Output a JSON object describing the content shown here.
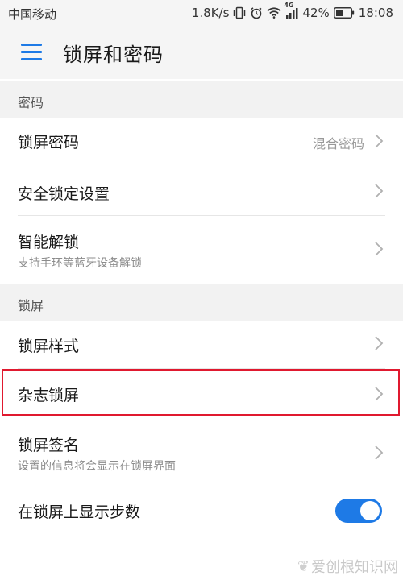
{
  "status_bar": {
    "carrier": "中国移动",
    "speed": "1.8K/s",
    "network": "4G",
    "battery": "42%",
    "time": "18:08"
  },
  "app_bar": {
    "title": "锁屏和密码"
  },
  "sections": {
    "password": {
      "header": "密码"
    },
    "lockscreen": {
      "header": "锁屏"
    }
  },
  "rows": {
    "lock_password": {
      "label": "锁屏密码",
      "value": "混合密码"
    },
    "security_lock": {
      "label": "安全锁定设置"
    },
    "smart_unlock": {
      "label": "智能解锁",
      "sub": "支持手环等蓝牙设备解锁"
    },
    "lock_style": {
      "label": "锁屏样式"
    },
    "magazine_lock": {
      "label": "杂志锁屏"
    },
    "lock_signature": {
      "label": "锁屏签名",
      "sub": "设置的信息将会显示在锁屏界面"
    },
    "show_steps": {
      "label": "在锁屏上显示步数",
      "toggle_on": true
    }
  },
  "watermark": {
    "text": "爱创根知识网"
  },
  "colors": {
    "accent": "#1e7ae6",
    "highlight": "#e0192f",
    "section_bg": "#f2f2f2"
  }
}
